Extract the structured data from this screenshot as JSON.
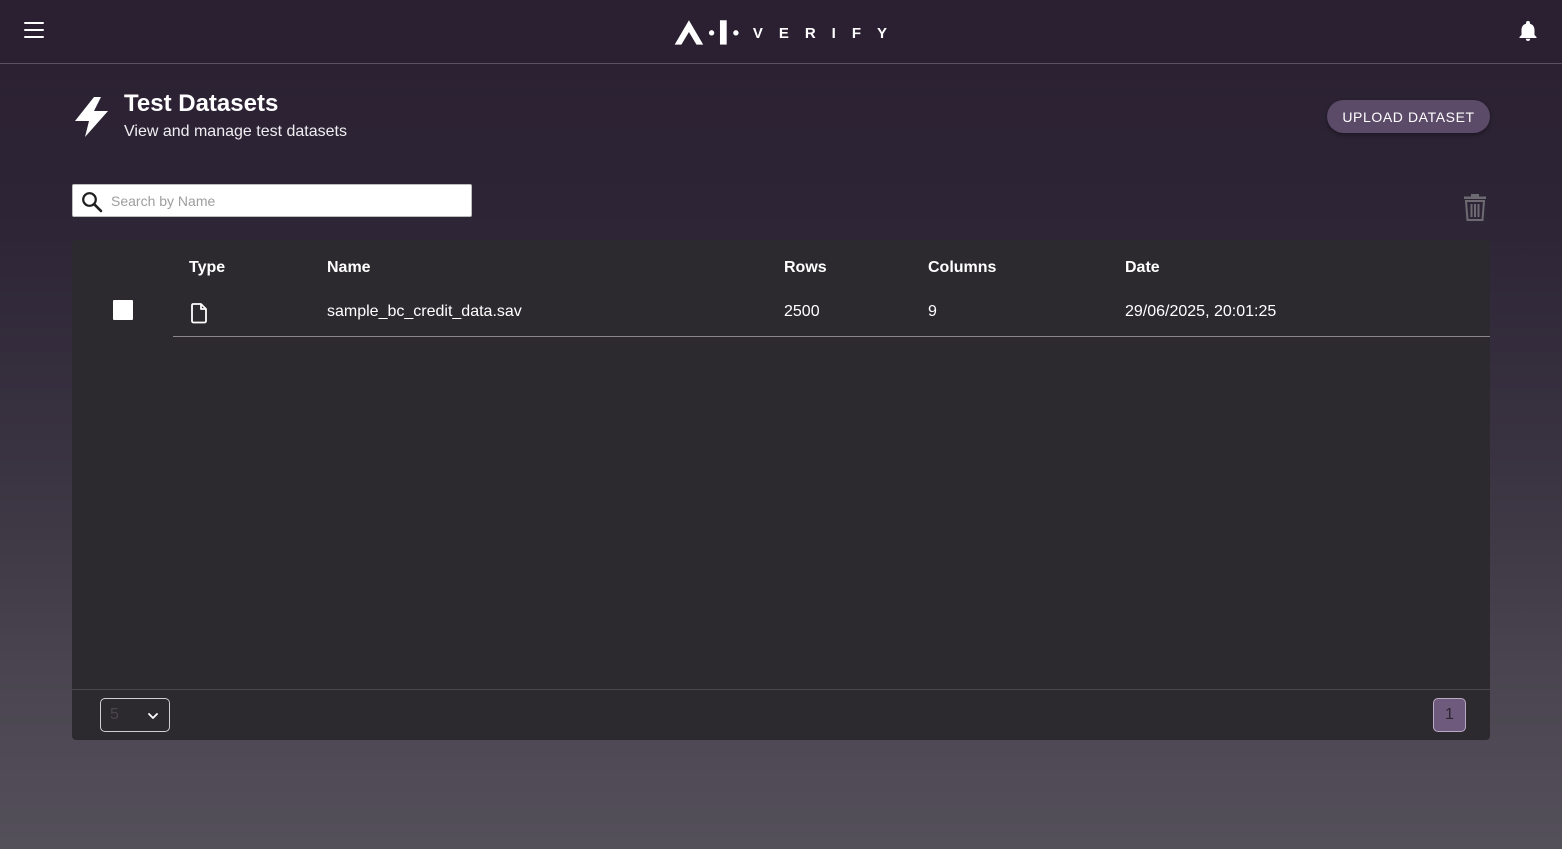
{
  "topbar": {
    "logo_text": "VERIFY",
    "menu_icon": "hamburger-menu-icon",
    "notification_icon": "bell-icon"
  },
  "header": {
    "icon": "lightning-bolt-icon",
    "title": "Test Datasets",
    "subtitle": "View and manage test datasets",
    "upload_label": "UPLOAD DATASET"
  },
  "search": {
    "placeholder": "Search by Name",
    "value": ""
  },
  "toolbar": {
    "delete_icon": "trash-icon"
  },
  "table": {
    "columns": [
      "Type",
      "Name",
      "Rows",
      "Columns",
      "Date"
    ],
    "rows": [
      {
        "selected": false,
        "type_icon": "file-icon",
        "name": "sample_bc_credit_data.sav",
        "rows": "2500",
        "columns": "9",
        "date": "29/06/2025, 20:01:25"
      }
    ]
  },
  "pagination": {
    "page_size": "5",
    "current_page": "1"
  },
  "colors": {
    "topbar_bg": "#2b1f32",
    "accent_button": "#5b4a68",
    "table_bg": "#2c2a2f",
    "active_page": "#6e5a7c"
  }
}
